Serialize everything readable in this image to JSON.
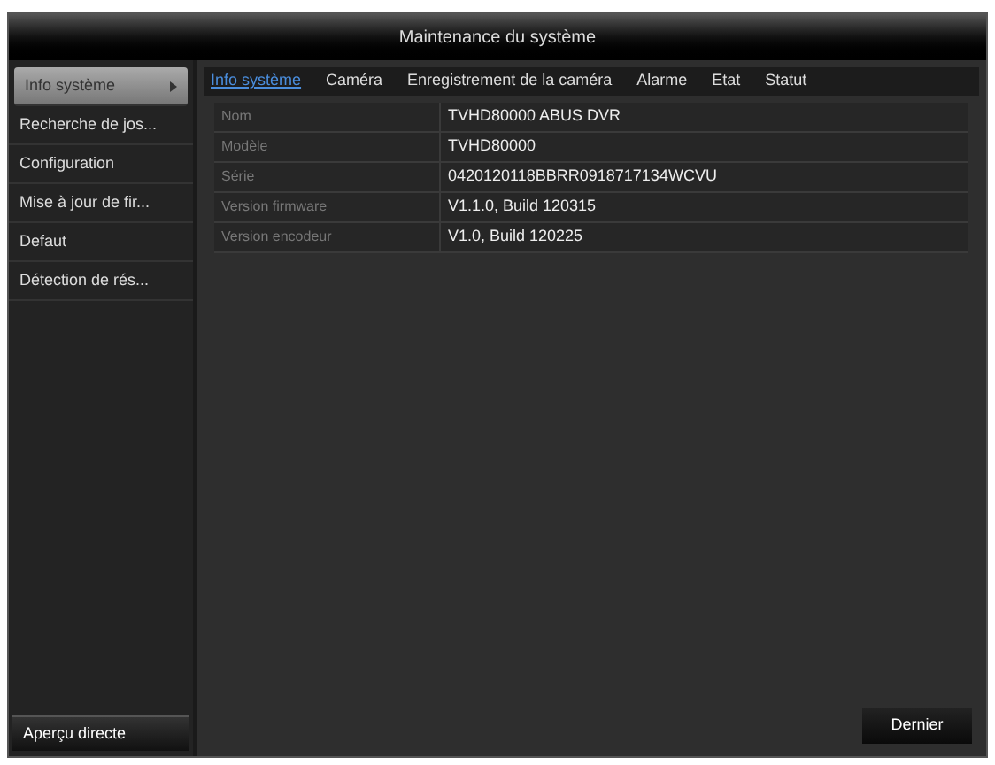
{
  "window": {
    "title": "Maintenance du système"
  },
  "sidebar": {
    "items": [
      {
        "label": "Info système",
        "selected": true
      },
      {
        "label": "Recherche de jos...",
        "selected": false
      },
      {
        "label": "Configuration",
        "selected": false
      },
      {
        "label": "Mise à jour de fir...",
        "selected": false
      },
      {
        "label": "Defaut",
        "selected": false
      },
      {
        "label": "Détection de rés...",
        "selected": false
      }
    ],
    "footer": "Aperçu directe"
  },
  "tabs": [
    {
      "label": "Info système",
      "selected": true
    },
    {
      "label": "Caméra",
      "selected": false
    },
    {
      "label": "Enregistrement de la caméra",
      "selected": false
    },
    {
      "label": "Alarme",
      "selected": false
    },
    {
      "label": "Etat",
      "selected": false
    },
    {
      "label": "Statut",
      "selected": false
    }
  ],
  "table": {
    "rows": [
      {
        "label": "Nom",
        "value": "TVHD80000 ABUS DVR"
      },
      {
        "label": "Modèle",
        "value": "TVHD80000"
      },
      {
        "label": "Série",
        "value": "0420120118BBRR0918717134WCVU"
      },
      {
        "label": "Version firmware",
        "value": "V1.1.0, Build 120315"
      },
      {
        "label": "Version encodeur",
        "value": "V1.0, Build 120225"
      }
    ]
  },
  "buttons": [
    "Dernier"
  ]
}
